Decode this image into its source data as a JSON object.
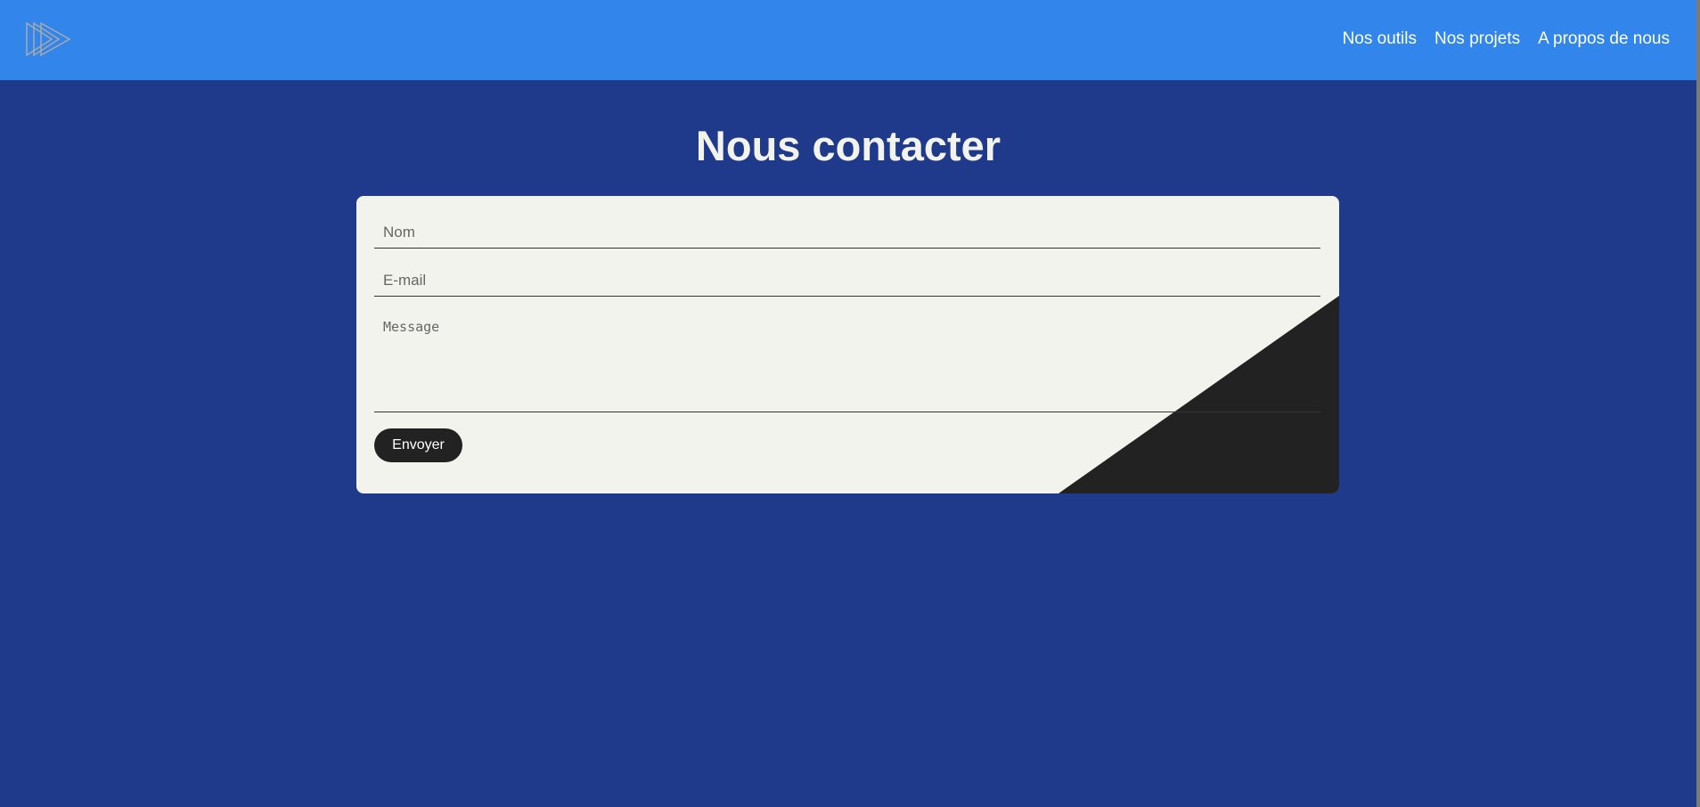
{
  "nav": {
    "logo_icon": "triple-play-arrows-logo",
    "links": [
      {
        "label": "Nos outils"
      },
      {
        "label": "Nos projets"
      },
      {
        "label": "A propos de nous"
      }
    ]
  },
  "page": {
    "title": "Nous contacter"
  },
  "form": {
    "name_placeholder": "Nom",
    "name_value": "",
    "email_placeholder": "E-mail",
    "email_value": "",
    "message_placeholder": "Message",
    "message_value": "",
    "submit_label": "Envoyer"
  },
  "colors": {
    "navbar": "#3185eb",
    "background": "#1f3a8a",
    "card": "#f3f3ee",
    "dark": "#222222",
    "text_light": "#f3f3ee"
  }
}
